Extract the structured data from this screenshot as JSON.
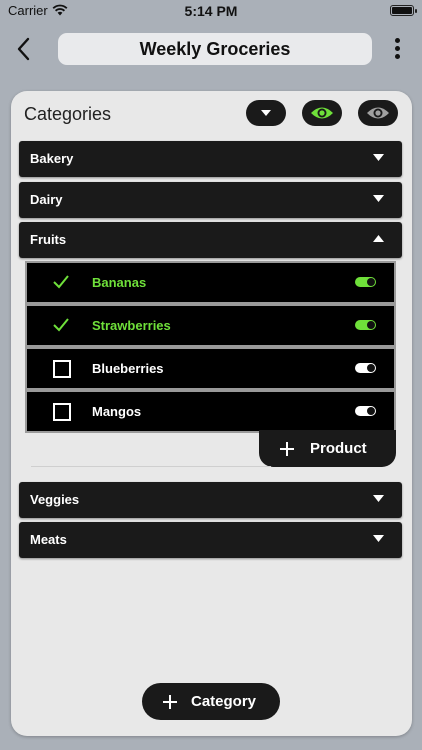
{
  "status_bar": {
    "carrier": "Carrier",
    "time": "5:14 PM"
  },
  "nav": {
    "title": "Weekly Groceries"
  },
  "panel": {
    "title": "Categories"
  },
  "categories": [
    {
      "label": "Bakery",
      "expanded": false
    },
    {
      "label": "Dairy",
      "expanded": false
    },
    {
      "label": "Fruits",
      "expanded": true
    },
    {
      "label": "Veggies",
      "expanded": false
    },
    {
      "label": "Meats",
      "expanded": false
    }
  ],
  "products": [
    {
      "label": "Bananas",
      "checked": true,
      "enabled": true
    },
    {
      "label": "Strawberries",
      "checked": true,
      "enabled": true
    },
    {
      "label": "Blueberries",
      "checked": false,
      "enabled": false
    },
    {
      "label": "Mangos",
      "checked": false,
      "enabled": false
    }
  ],
  "actions": {
    "add_product_label": "Product",
    "add_category_label": "Category"
  },
  "colors": {
    "accent": "#6fe03a",
    "dark": "#1a1a1a",
    "panel": "#e8e8e8",
    "header": "#aab0b8"
  },
  "icons": {
    "back": "chevron-left-icon",
    "more": "more-vertical-icon",
    "collapse": "triangle-down-icon",
    "visible": "eye-icon",
    "hidden": "eye-icon",
    "check": "checkmark-icon",
    "add": "plus-icon"
  }
}
